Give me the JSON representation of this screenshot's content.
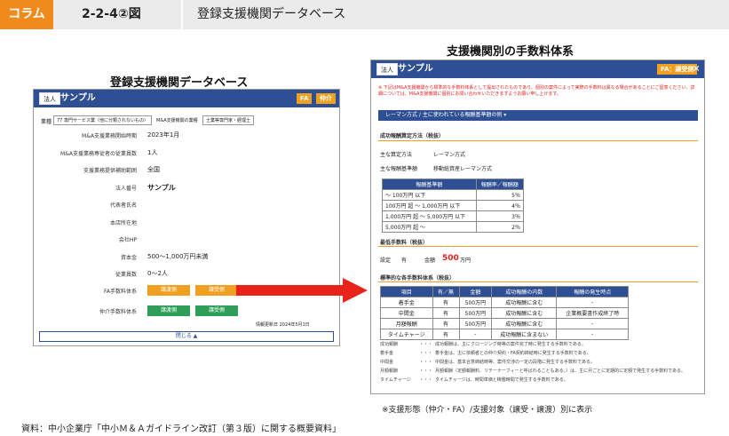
{
  "header": {
    "tag": "コラム",
    "number": "2-2-4②図",
    "title": "登録支援機関データベース"
  },
  "left": {
    "caption": "登録支援機関データベース",
    "badge": "法人",
    "name": "サンプル",
    "btn_fa": "FA",
    "btn_chukai": "仲介",
    "industry_label": "業種",
    "industry_value": "77 専門サービス業（他に分類されないもの）",
    "cert_label": "M&A支援機関の業種",
    "cert_value": "士業等専門家・経理士",
    "rows": [
      {
        "label": "M&A支援業務開始時期",
        "value": "2023年1月"
      },
      {
        "label": "M&A支援業務専従者の従業員数",
        "value": "1人"
      },
      {
        "label": "支援業務提供補助範囲",
        "value": "全国"
      },
      {
        "label": "法人番号",
        "value": "サンプル"
      },
      {
        "label": "代表者氏名",
        "value": ""
      },
      {
        "label": "本店所在地",
        "value": ""
      },
      {
        "label": "会社HP",
        "value": ""
      },
      {
        "label": "資本金",
        "value": "500～1,000万円未満"
      },
      {
        "label": "従業員数",
        "value": "0～2人"
      }
    ],
    "fa_label": "FA手数料体系",
    "chukai_label": "仲介手数料体系",
    "btn_jyoto": "譲渡側",
    "btn_jyuju": "譲受側",
    "updated": "情報更新日 2024年5月1日",
    "close": "閉じる ▲"
  },
  "right": {
    "caption": "支援機関別の手数料体系",
    "badge": "法人",
    "name": "サンプル",
    "mode_badge": "FA：譲受側",
    "close_x": "×",
    "notice": "※ 下記はM&A支援機関から標準的な手数料体系として提出されたものであり、個別の案件によって実際の手数料は異なる場合があることにご留意ください。詳細については、M&A支援機関に個別にお問い合わせいただきますようお願い申し上げます。",
    "dropdown": "レーマン方式 / 主に使われている報酬基準額の例 ▾",
    "success_title": "成功報酬算定方法（税抜）",
    "main_method_label": "主な算定方法",
    "main_method_value": "レーマン方式",
    "base_label": "主な報酬基準額",
    "base_value": "移動総資産レーマン方式",
    "rate_table": {
      "headers": [
        "報酬基準額",
        "報酬率／報酬額"
      ],
      "rows": [
        [
          "～ 100万円 以下",
          "5％"
        ],
        [
          "100万円 超 ～ 1,000万円 以下",
          "4％"
        ],
        [
          "1,000万円 超 ～ 5,000万円 以下",
          "3％"
        ],
        [
          "5,000万円 超 ～",
          "2％"
        ]
      ]
    },
    "min_title": "最低手数料（税抜）",
    "min_set_label": "設定",
    "min_set_value": "有",
    "min_amount_label": "金額",
    "min_amount_value": "500",
    "min_amount_unit": "万円",
    "fee_title": "標準的な各手数料体系（税抜）",
    "fee_table": {
      "headers": [
        "項目",
        "有／無",
        "金額",
        "成功報酬の内数",
        "報酬の発生時点"
      ],
      "rows": [
        [
          "着手金",
          "有",
          "500万円",
          "成功報酬に含む",
          "-"
        ],
        [
          "中間金",
          "有",
          "500万円",
          "成功報酬に含む",
          "企業概要書作成終了時"
        ],
        [
          "月額報酬",
          "有",
          "500万円",
          "成功報酬に含む",
          "-"
        ],
        [
          "タイムチャージ",
          "有",
          "-",
          "成功報酬に含まない",
          "-"
        ]
      ]
    },
    "notes": [
      [
        "成功報酬",
        "・・・",
        "成功報酬は、主にクロージング時等の案件完了時に発生する手数料である。"
      ],
      [
        "着手金",
        "・・・",
        "着手金は、主に依頼者との仲介契約・FA契約締結時に発生する手数料である。"
      ],
      [
        "中間金",
        "・・・",
        "中間金は、基本合意締結時等、案件交渉の一定の段階に発生する手数料である。"
      ],
      [
        "月額報酬",
        "・・・",
        "月額報酬（定額報酬料、リテーナーフィーと呼ばれることもある。）は、主に月ごとに定期的に定額で発生する手数料である。"
      ],
      [
        "タイムチャージ",
        "・・・",
        "タイムチャージは、時間単価と稼働時間で発生する手数料である。"
      ]
    ],
    "footnote": "※支援形態（仲介・FA）/支援対象（譲受・譲渡）別に表示"
  },
  "source": "資料：中小企業庁「中小Ｍ＆Ａガイドライン改訂（第３版）に関する概要資料」",
  "colors": {
    "accent": "#f08a1c",
    "navy": "#2f4f94",
    "green": "#2e9e5a",
    "arrow": "#e8231c",
    "red": "#e02020"
  }
}
